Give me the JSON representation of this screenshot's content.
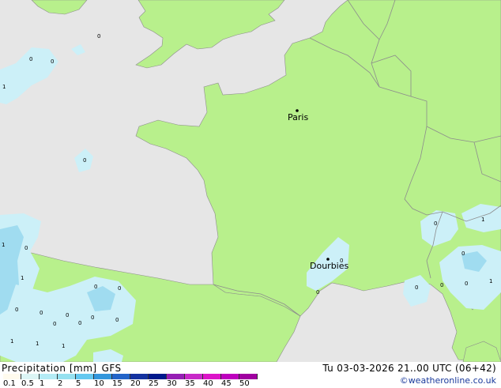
{
  "map": {
    "cities": [
      {
        "name": "Paris"
      },
      {
        "name": "Dourbies"
      }
    ],
    "cell_values": [
      "0",
      "0",
      "0",
      "1",
      "0",
      "1",
      "0",
      "1",
      "0",
      "0",
      "0",
      "0",
      "0",
      "0",
      "0",
      "0",
      "0",
      "1",
      "1",
      "1",
      "0",
      "0",
      "0",
      "1",
      "0",
      "0",
      "0",
      "1",
      "0"
    ]
  },
  "legend": {
    "title": "Precipitation [mm]",
    "model": "GFS",
    "scale_labels": [
      "0.1",
      "0.5",
      "1",
      "2",
      "5",
      "10",
      "15",
      "20",
      "25",
      "30",
      "35",
      "40",
      "45",
      "50"
    ],
    "scale_colors": [
      "#fffbee",
      "#dcf5f5",
      "#b4ebf5",
      "#96e1f0",
      "#64c8f0",
      "#3296dc",
      "#2364c8",
      "#1432a0",
      "#00198c",
      "#961eb4",
      "#c828c8",
      "#dc14c8",
      "#be00be",
      "#a000a0"
    ]
  },
  "valid_time": "Tu 03-03-2026 21..00 UTC (06+42)",
  "credit": "©weatheronline.co.uk",
  "colors": {
    "sea": "#e6e6e6",
    "land": "#b8f08c",
    "precip_light": "#ccf0f8",
    "precip_medium": "#a0dcf0",
    "border": "#8c8c8c"
  }
}
